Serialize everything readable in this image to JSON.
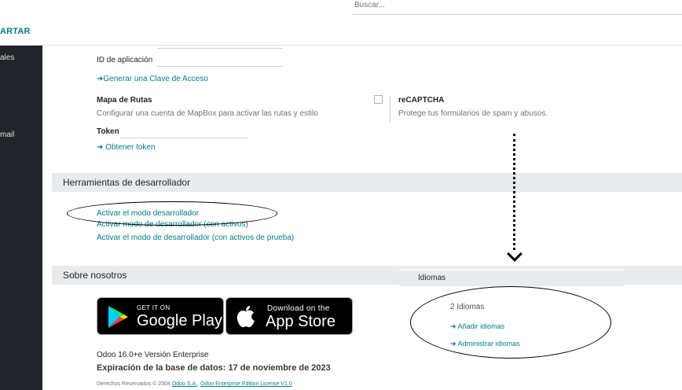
{
  "topbar": {
    "search_placeholder": "Buscar...",
    "discard": "ARTAR"
  },
  "sidebar": {
    "items": [
      {
        "label": "ales"
      },
      {
        "label": "mail"
      }
    ]
  },
  "app_id": {
    "label": "ID de aplicación",
    "generate_link": "Generar una Clave de Acceso"
  },
  "map": {
    "title": "Mapa de Rutas",
    "description": "Configurar una cuenta de MapBox para activar las rutas y estilo",
    "token_label": "Token",
    "token_link": "Obtener token"
  },
  "recaptcha": {
    "title": "reCAPTCHA",
    "description": "Protege tus formularios de spam y abusos."
  },
  "dev_tools": {
    "title": "Herramientas de desarrollador",
    "activate": "Activar el modo desarrollador",
    "activate_assets": "Activar modo de desarrollador (con activos)",
    "activate_test_assets": "Activar el modo de desarrollador (con activos de prueba)"
  },
  "about": {
    "title": "Sobre nosotros",
    "google": {
      "small": "GET IT ON",
      "big": "Google Play"
    },
    "apple": {
      "small": "Download on the",
      "big": "App Store"
    },
    "version": "Odoo 16.0+e Versión Enterprise",
    "expiration": "Expiración de la base de datos: 17 de noviembre de 2023",
    "rights_prefix": "Derechos Reservados © 2004 ",
    "rights_link1": "Odoo S.A.",
    "rights_link2": "Odoo Enterprise Edition License V1.0"
  },
  "languages": {
    "title": "Idiomas",
    "count": "2 Idiomas",
    "add": "Añadir idiomas",
    "manage": "Administrar idiomas"
  }
}
